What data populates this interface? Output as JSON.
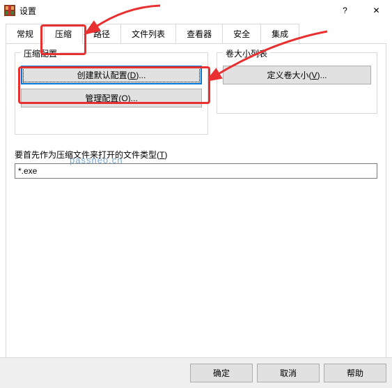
{
  "window": {
    "title": "设置"
  },
  "titlebar_buttons": {
    "help": "?",
    "close": "✕"
  },
  "tabs": [
    "常规",
    "压缩",
    "路径",
    "文件列表",
    "查看器",
    "安全",
    "集成"
  ],
  "active_tab_index": 1,
  "groups": {
    "compress": {
      "legend": "压缩配置",
      "create_label_pre": "创建默认配置(",
      "create_hotkey": "D",
      "create_label_post": ")...",
      "manage_label_pre": "管理配置(",
      "manage_hotkey": "O",
      "manage_label_post": ")..."
    },
    "volume": {
      "legend": "卷大小列表",
      "define_label_pre": "定义卷大小(",
      "define_hotkey": "V",
      "define_label_post": ")..."
    }
  },
  "filetype": {
    "label_pre": "要首先作为压缩文件来打开的文件类型(",
    "label_hotkey": "T",
    "label_post": ")",
    "value": "*.exe"
  },
  "footer": {
    "ok": "确定",
    "cancel": "取消",
    "help": "帮助"
  },
  "watermark": "passneo.cn",
  "annotation_color": "#e83030"
}
